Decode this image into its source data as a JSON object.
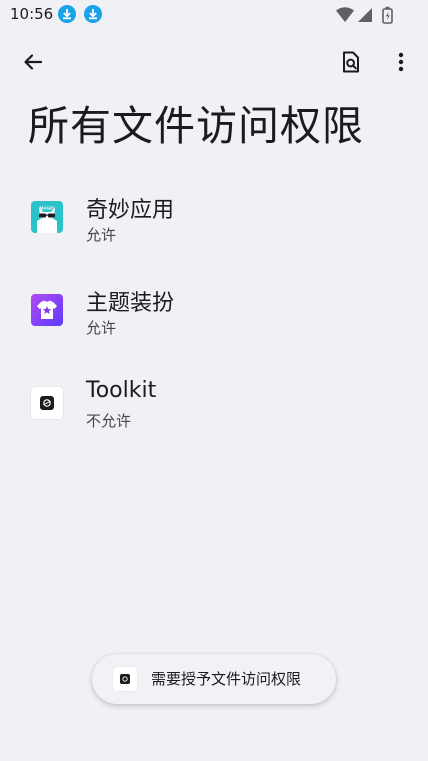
{
  "status_bar": {
    "time": "10:56",
    "notification_icons": [
      "download-icon",
      "download-icon"
    ],
    "system_icons": [
      "wifi-icon",
      "cell-signal-icon",
      "battery-charging-icon"
    ]
  },
  "app_bar": {
    "back_icon": "arrow-back-icon",
    "search_doc_icon": "document-search-icon",
    "overflow_icon": "more-vert-icon"
  },
  "page": {
    "title": "所有文件访问权限"
  },
  "apps": [
    {
      "name": "奇妙应用",
      "status": "允许",
      "icon": "magic-app-icon",
      "icon_text": "MAGIC"
    },
    {
      "name": "主题装扮",
      "status": "允许",
      "icon": "theme-tshirt-icon"
    },
    {
      "name": "Toolkit",
      "status": "不允许",
      "icon": "toolkit-icon"
    }
  ],
  "toast": {
    "text": "需要授予文件访问权限",
    "icon": "toolkit-icon"
  },
  "colors": {
    "background": "#f0f1f5",
    "download_badge": "#1aa3e8",
    "magic_teal": "#2bc3c9",
    "theme_purple": "#8a3df0"
  }
}
